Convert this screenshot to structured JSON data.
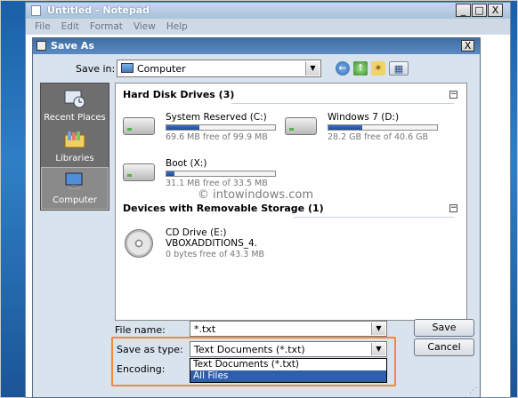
{
  "notepad": {
    "title": "Untitled - Notepad",
    "menu": [
      "File",
      "Edit",
      "Format",
      "View",
      "Help"
    ],
    "min": "_",
    "max": "□",
    "close": "X"
  },
  "dialog": {
    "title": "Save As",
    "close": "X",
    "save_in_label": "Save in:",
    "save_in_value": "Computer",
    "places": [
      {
        "label": "Recent Places"
      },
      {
        "label": "Libraries"
      },
      {
        "label": "Computer"
      }
    ],
    "groups": {
      "hdd_title": "Hard Disk Drives (3)",
      "removable_title": "Devices with Removable Storage (1)"
    },
    "drives": [
      {
        "name": "System Reserved (C:)",
        "free": "69.6 MB free of 99.9 MB",
        "used_fraction": 0.3
      },
      {
        "name": "Windows 7 (D:)",
        "free": "28.2 GB free of 40.6 GB",
        "used_fraction": 0.31
      },
      {
        "name": "Boot (X:)",
        "free": "31.1 MB free of 33.5 MB",
        "used_fraction": 0.07
      }
    ],
    "cd": {
      "name": "CD Drive (E:)",
      "label": "VBOXADDITIONS_4.",
      "free": "0 bytes free of 43.3 MB"
    },
    "watermark": "© intowindows.com",
    "file_name_label": "File name:",
    "file_name_value": "*.txt",
    "save_as_type_label": "Save as type:",
    "save_as_type_value": "Text Documents (*.txt)",
    "encoding_label": "Encoding:",
    "type_options": [
      "Text Documents (*.txt)",
      "All Files"
    ],
    "save_button": "Save",
    "cancel_button": "Cancel",
    "collapse_glyph": "−",
    "dropdown_glyph": "▼"
  }
}
